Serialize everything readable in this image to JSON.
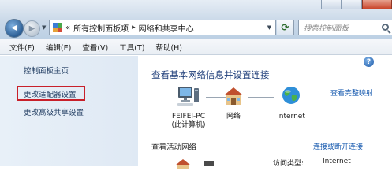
{
  "titlebar": {
    "window_controls": [
      "minimize",
      "maximize",
      "close"
    ]
  },
  "address_bar": {
    "overflow": "«",
    "crumbs": [
      "所有控制面板项",
      "网络和共享中心"
    ],
    "separator": "▸"
  },
  "search": {
    "placeholder": "搜索控制面板"
  },
  "menu": {
    "items": [
      "文件(F)",
      "编辑(E)",
      "查看(V)",
      "工具(T)",
      "帮助(H)"
    ]
  },
  "sidebar": {
    "items": [
      {
        "label": "控制面板主页"
      },
      {
        "label": "更改适配器设置",
        "highlighted": true
      },
      {
        "label": "更改高级共享设置"
      }
    ],
    "highlight_color": "#c8202a"
  },
  "main": {
    "heading": "查看基本网络信息并设置连接",
    "full_map_link": "查看完整映射",
    "nodes": [
      {
        "icon": "computer-icon",
        "label_line1": "FEIFEI-PC",
        "label_line2": "(此计算机)"
      },
      {
        "icon": "house-icon",
        "label_line1": "网络"
      },
      {
        "icon": "globe-icon",
        "label_line1": "Internet"
      }
    ],
    "active_networks_label": "查看活动网络",
    "connect_link": "连接或断开连接",
    "access_type_label": "访问类型:",
    "access_type_value": "Internet"
  },
  "colors": {
    "heading": "#1f3e7a",
    "link": "#1a5cb0",
    "sidebar_bg": "#e8f0f8"
  }
}
